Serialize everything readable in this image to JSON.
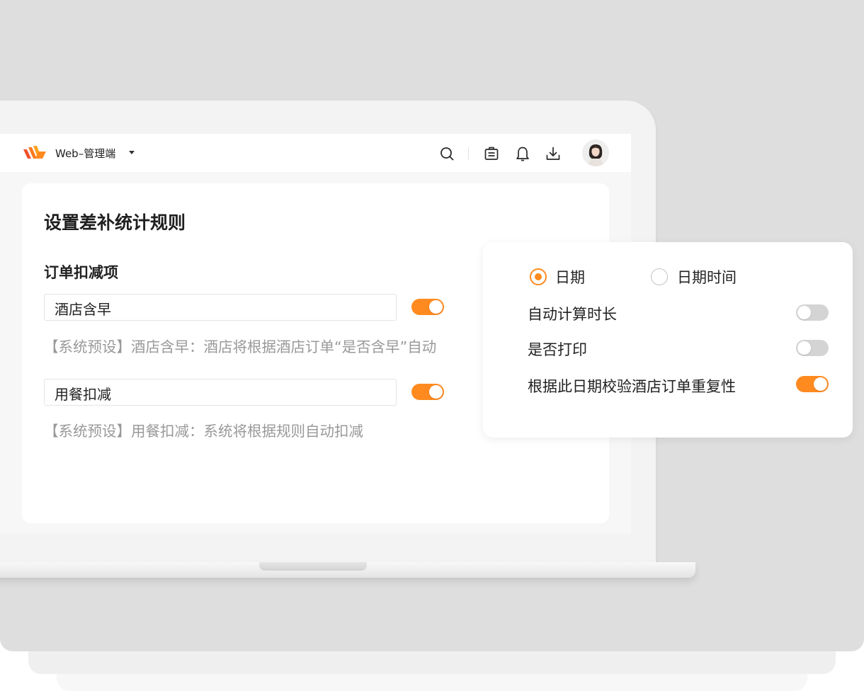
{
  "header": {
    "app_name": "Web–管理端",
    "icons": [
      "search-icon",
      "clipboard-icon",
      "bell-icon",
      "download-icon"
    ]
  },
  "card": {
    "title": "设置差补统计规则",
    "section_title": "订单扣减项",
    "items": [
      {
        "name": "酒店含早",
        "enabled": true,
        "note": "【系统预设】酒店含早：酒店将根据酒店订单“是否含早”自动"
      },
      {
        "name": "用餐扣减",
        "enabled": true,
        "note": "【系统预设】用餐扣减：系统将根据规则自动扣减"
      }
    ]
  },
  "popup": {
    "date_mode": {
      "options": [
        {
          "label": "日期",
          "checked": true
        },
        {
          "label": "日期时间",
          "checked": false
        }
      ]
    },
    "settings": [
      {
        "label": "自动计算时长",
        "enabled": false
      },
      {
        "label": "是否打印",
        "enabled": false
      },
      {
        "label": "根据此日期校验酒店订单重复性",
        "enabled": true
      }
    ]
  },
  "colors": {
    "accent": "#ff8a1f",
    "toggle_off": "#d4d4d4",
    "note_text": "#999999"
  }
}
